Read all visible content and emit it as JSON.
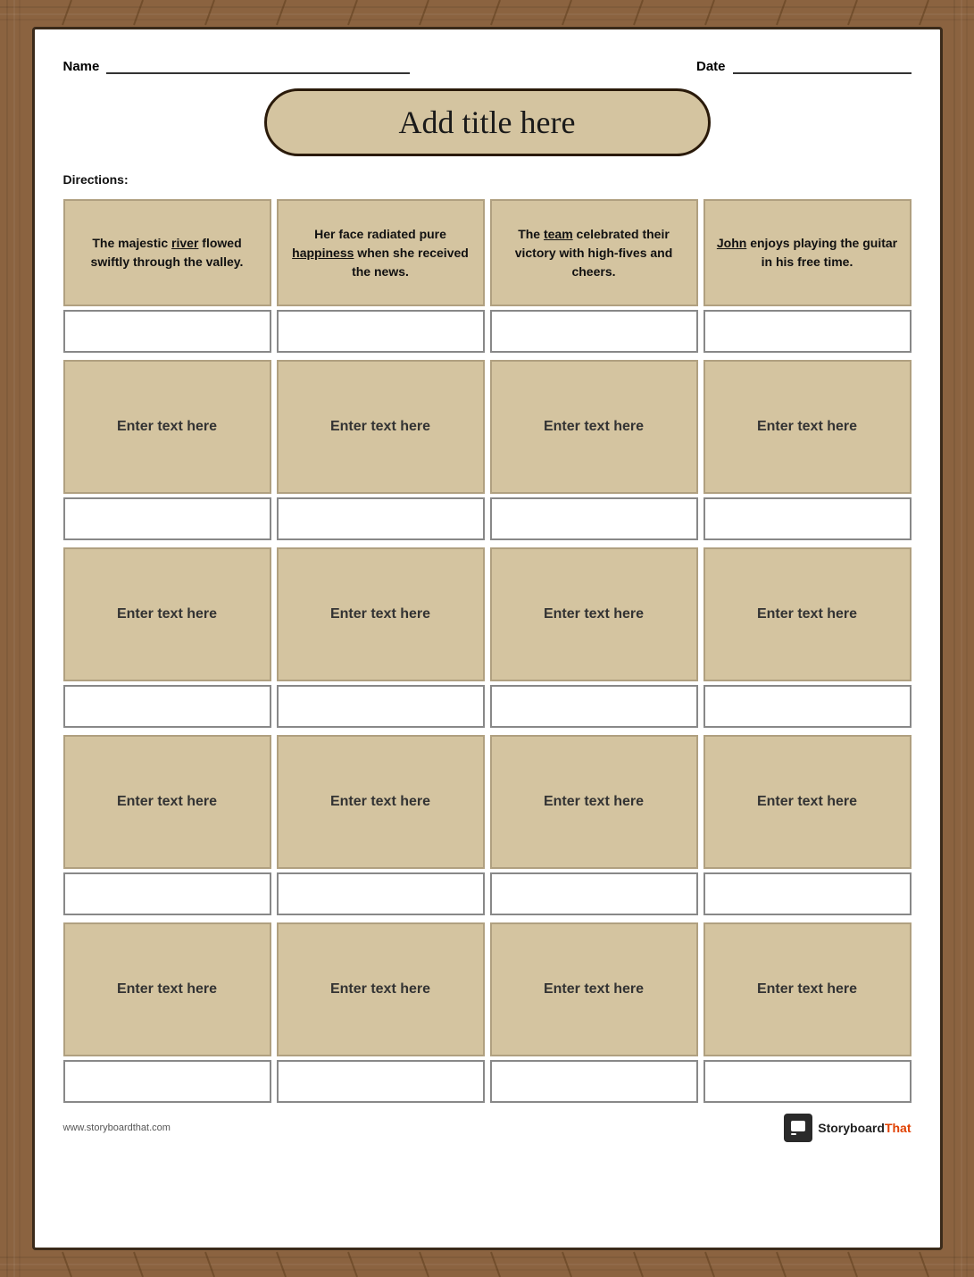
{
  "header": {
    "name_label": "Name",
    "date_label": "Date"
  },
  "title": "Add title here",
  "directions": "Directions:",
  "sentences": [
    {
      "text_parts": [
        {
          "text": "The majestic ",
          "style": "normal"
        },
        {
          "text": "river",
          "style": "underline-bold"
        },
        {
          "text": " flowed swiftly through the valley.",
          "style": "normal"
        }
      ],
      "display": "The majestic river flowed swiftly through the valley."
    },
    {
      "text_parts": [
        {
          "text": "Her face radiated pure ",
          "style": "normal"
        },
        {
          "text": "happiness",
          "style": "underline-bold"
        },
        {
          "text": " when she received the news.",
          "style": "normal"
        }
      ],
      "display": "Her face radiated pure happiness when she received the news."
    },
    {
      "text_parts": [
        {
          "text": "The ",
          "style": "normal"
        },
        {
          "text": "team",
          "style": "underline-bold"
        },
        {
          "text": " celebrated their victory with high-fives and cheers.",
          "style": "normal"
        }
      ],
      "display": "The team celebrated their victory with high-fives and cheers."
    },
    {
      "text_parts": [
        {
          "text": "John",
          "style": "underline-bold"
        },
        {
          "text": " enjoys playing the guitar in his free time.",
          "style": "normal"
        }
      ],
      "display": "John enjoys playing the guitar in his free time."
    }
  ],
  "content_rows": [
    [
      "Enter text here",
      "Enter text here",
      "Enter text here",
      "Enter text here"
    ],
    [
      "Enter text here",
      "Enter text here",
      "Enter text here",
      "Enter text here"
    ],
    [
      "Enter text here",
      "Enter text here",
      "Enter text here",
      "Enter text here"
    ],
    [
      "Enter text here",
      "Enter text here",
      "Enter text here",
      "Enter text here"
    ]
  ],
  "footer": {
    "url": "www.storyboardthat.com",
    "logo_text": "Storyboard",
    "logo_sub": "That"
  }
}
